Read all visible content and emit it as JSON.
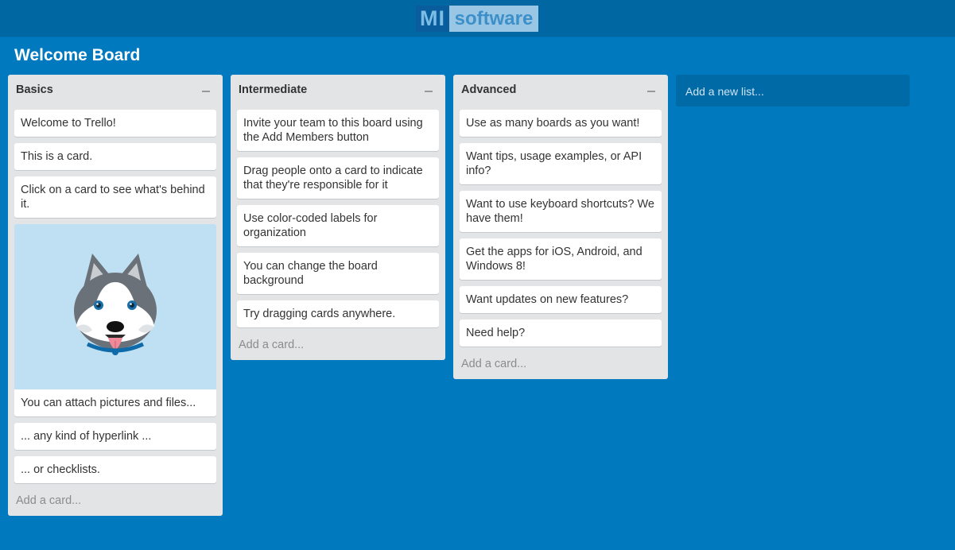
{
  "header": {
    "logo_mi": "MI",
    "logo_software": "software"
  },
  "board": {
    "title": "Welcome Board"
  },
  "lists": [
    {
      "title": "Basics",
      "cards": [
        "Welcome to Trello!",
        "This is a card.",
        "Click on a card to see what's behind it.",
        "You can attach pictures and files...",
        "... any kind of hyperlink ...",
        "... or checklists."
      ],
      "image_card_index": 3,
      "image_icon": "husky-dog-icon",
      "add_card": "Add a card..."
    },
    {
      "title": "Intermediate",
      "cards": [
        "Invite your team to this board using the Add Members button",
        "Drag people onto a card to indicate that they're responsible for it",
        "Use color-coded labels for organization",
        "You can change the board background",
        "Try dragging cards anywhere."
      ],
      "add_card": "Add a card..."
    },
    {
      "title": "Advanced",
      "cards": [
        "Use as many boards as you want!",
        "Want tips, usage examples, or API info?",
        "Want to use keyboard shortcuts? We have them!",
        "Get the apps for iOS, Android, and Windows 8!",
        "Want updates on new features?",
        "Need help?"
      ],
      "add_card": "Add a card..."
    }
  ],
  "add_list": "Add a new list...",
  "colors": {
    "board_bg": "#0079bf",
    "header_bg": "#0067a3",
    "list_bg": "#e2e4e6",
    "card_bg": "#ffffff",
    "image_bg": "#bfe0f2"
  }
}
